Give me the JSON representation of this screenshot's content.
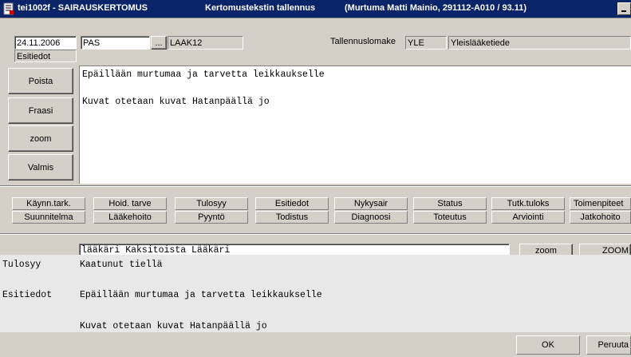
{
  "window": {
    "title_app": "tei1002f - SAIRAUSKERTOMUS",
    "title_section": "Kertomustekstin tallennus",
    "title_patient": "(Murtuma Matti Mainio, 291112-A010 / 93.11)"
  },
  "header": {
    "date": "24.11.2006",
    "code": "PAS",
    "browse_label": "...",
    "laak": "LAAK12",
    "section_label": "Esitiedot",
    "form_label": "Tallennuslomake",
    "form_code": "YLE",
    "form_name": "Yleislääketiede"
  },
  "side_buttons": {
    "poista": "Poista",
    "fraasi": "Fraasi",
    "zoom": "zoom",
    "valmis": "Valmis"
  },
  "editor": {
    "lines": [
      "Epäillään murtumaa ja tarvetta leikkaukselle",
      "",
      "Kuvat otetaan kuvat Hatanpäällä jo"
    ]
  },
  "headings_row1": [
    "Käynn.tark.",
    "Hoid. tarve",
    "Tulosyy",
    "Esitiedot",
    "Nykysair",
    "Status",
    "Tutk.tuloks",
    "Toimenpiteet"
  ],
  "headings_row2": [
    "Suunnitelma",
    "Lääkehoito",
    "Pyyntö",
    "Todistus",
    "Diagnoosi",
    "Toteutus",
    "Arviointi",
    "Jatkohoito"
  ],
  "preview": {
    "author": "lääkäri  Kaksitoista Lääkäri",
    "zoom_small": "zoom",
    "zoom_big": "ZOOM",
    "entries": [
      {
        "label": "Tulosyy",
        "text": "Kaatunut tiellä"
      },
      {
        "label": "Esitiedot",
        "text": "Epäillään murtumaa ja tarvetta leikkaukselle"
      },
      {
        "label": "",
        "text": "Kuvat otetaan kuvat Hatanpäällä jo"
      }
    ]
  },
  "footer": {
    "ok": "OK",
    "cancel": "Peruuta"
  },
  "colors": {
    "titlebar": "#0a246a",
    "face": "#d4d0c8"
  }
}
